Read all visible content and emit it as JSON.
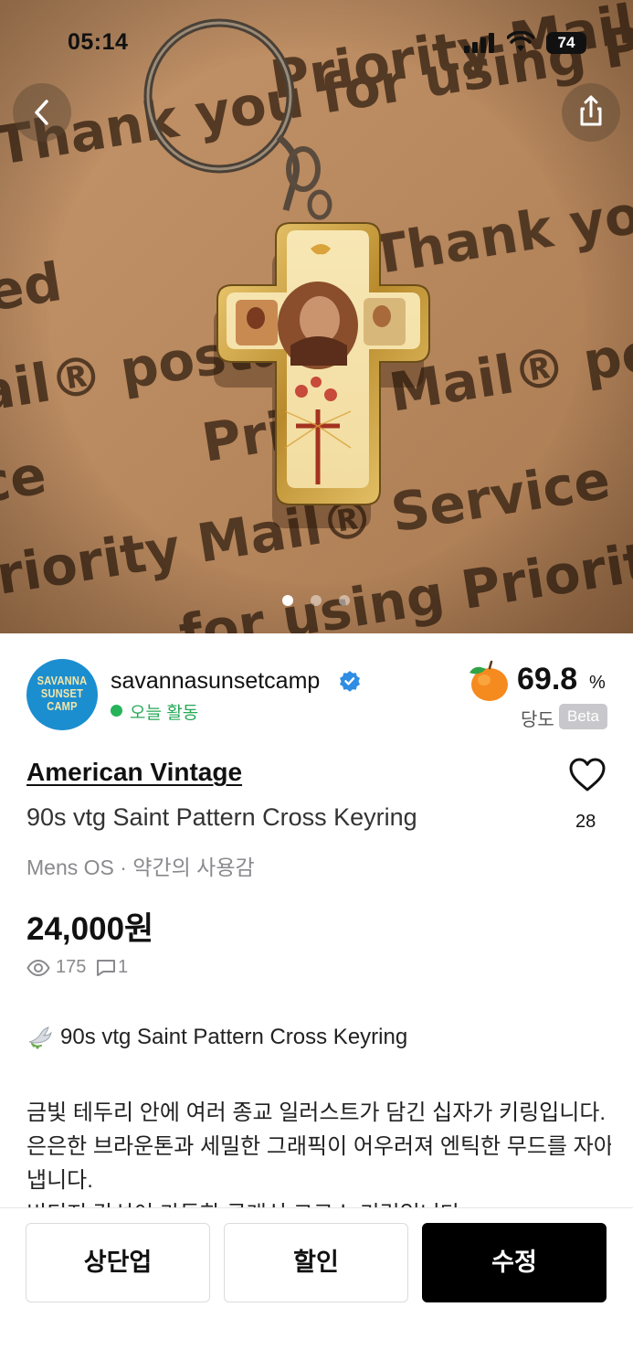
{
  "status_bar": {
    "time": "05:14",
    "battery": "74"
  },
  "hero": {
    "background_words": [
      "Priority Mail® Service",
      "Thank you for using Priority Mail®",
      "Thank you",
      "ed",
      "ail® postal",
      "Mail® post",
      "Pri",
      "ce",
      "riority Mail® Service",
      "for using Priority M"
    ],
    "page_count": 3,
    "current_page": 1
  },
  "seller": {
    "avatar_lines": [
      "SAVANNA",
      "SUNSET",
      "CAMP"
    ],
    "name": "savannasunsetcamp",
    "activity": "오늘 활동",
    "score": "69.8",
    "score_unit": "%",
    "score_label": "당도",
    "beta_label": "Beta"
  },
  "product": {
    "brand": "American Vintage",
    "title": "90s vtg Saint Pattern Cross Keyring",
    "meta": "Mens OS · 약간의 사용감",
    "price": "24,000원",
    "views": "175",
    "comments": "1",
    "likes": "28"
  },
  "description": {
    "headline": "90s vtg Saint Pattern Cross Keyring",
    "lines": [
      "금빛 테두리 안에 여러 종교 일러스트가 담긴 십자가 키링입니다.",
      "은은한 브라운톤과 세밀한 그래픽이 어우러져 엔틱한 무드를 자아",
      "냅니다.",
      "빈티지 감성이 가득한 클래식 크로스 키링입니다."
    ]
  },
  "actions": {
    "bump": "상단업",
    "discount": "할인",
    "edit": "수정"
  },
  "colors": {
    "accent_green": "#27b35a",
    "verified_blue": "#2f8de4",
    "primary_button": "#000000"
  }
}
